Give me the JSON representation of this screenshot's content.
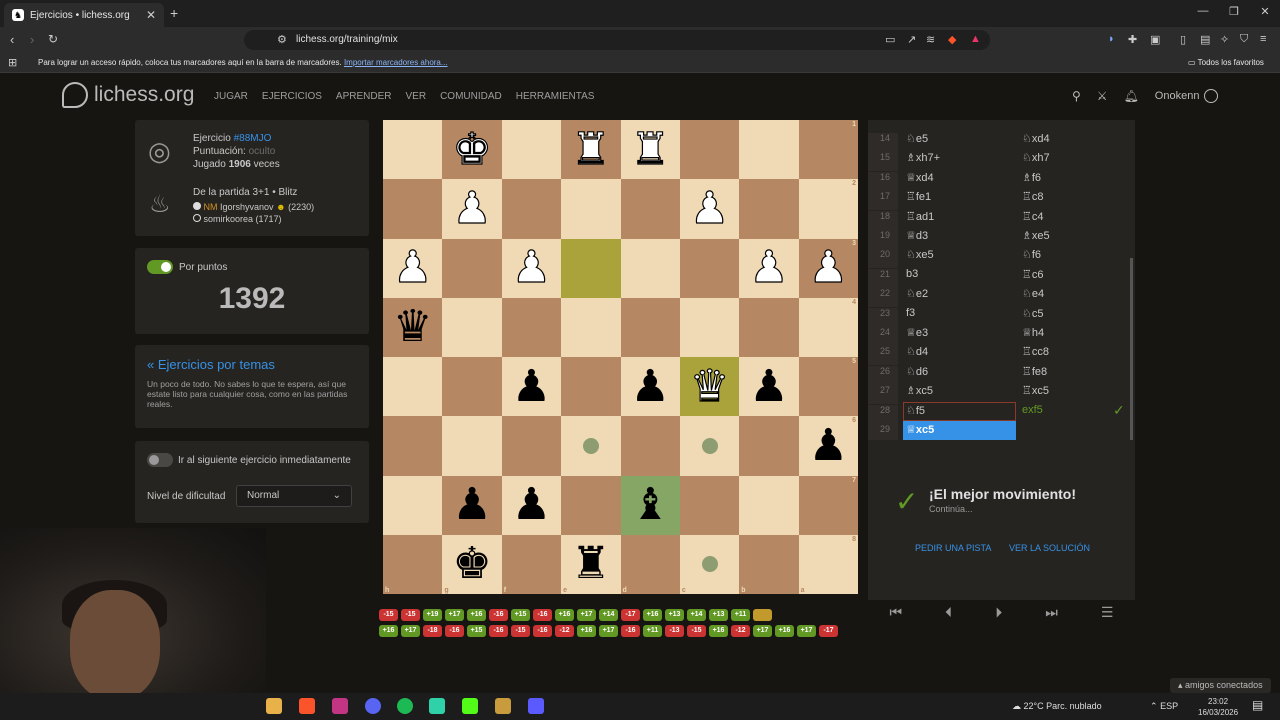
{
  "browser": {
    "tab_title": "Ejercicios • lichess.org",
    "new_tab": "+",
    "url": "lichess.org/training/mix",
    "bookmarks_text": "Para lograr un acceso rápido, coloca tus marcadores aquí en la barra de marcadores.",
    "bookmarks_link": "Importar marcadores ahora...",
    "all_favorites": "Todos los favoritos"
  },
  "site": {
    "logo": "lichess.org",
    "nav": [
      "JUGAR",
      "EJERCICIOS",
      "APRENDER",
      "VER",
      "COMUNIDAD",
      "HERRAMIENTAS"
    ],
    "username": "Onokenn"
  },
  "puzzle": {
    "exercise_label": "Ejercicio",
    "exercise_id": "#88MJO",
    "rating_label": "Puntuación:",
    "rating_value": "oculto",
    "played_label": "Jugado",
    "played_count": "1906",
    "played_suffix": "veces",
    "game_line": "De la partida 3+1 • Blitz",
    "player1_title": "NM",
    "player1": "Igorshyvanov",
    "player1_rating": "(2230)",
    "player2": "somirkoorea (1717)"
  },
  "rated": {
    "label": "Por puntos",
    "score": "1392"
  },
  "theme": {
    "link": "« Ejercicios por temas",
    "desc": "Un poco de todo. No sabes lo que te espera, así que estate listo para cualquier cosa, como en las partidas reales."
  },
  "settings": {
    "auto_next": "Ir al siguiente ejercicio inmediatamente",
    "difficulty_label": "Nivel de dificultad",
    "difficulty_value": "Normal"
  },
  "board": {
    "ranks": [
      "1",
      "2",
      "3",
      "4",
      "5",
      "6",
      "7",
      "8"
    ],
    "files": [
      "h",
      "g",
      "f",
      "e",
      "d",
      "c",
      "b",
      "a"
    ],
    "pieces": [
      [
        "",
        "wK",
        "",
        "wR",
        "wR",
        "",
        "",
        ""
      ],
      [
        "",
        "wP",
        "",
        "",
        "",
        "wP",
        "",
        ""
      ],
      [
        "wP",
        "",
        "wP",
        "",
        "",
        "",
        "wP",
        "wP"
      ],
      [
        "bQ",
        "",
        "",
        "",
        "",
        "",
        "",
        ""
      ],
      [
        "",
        "",
        "bP",
        "",
        "bP",
        "wQ",
        "bP",
        ""
      ],
      [
        "",
        "",
        "",
        "",
        "",
        "",
        "",
        "bP"
      ],
      [
        "",
        "bP",
        "bP",
        "",
        "bB",
        "",
        "",
        ""
      ],
      [
        "",
        "bK",
        "",
        "bR",
        "",
        "",
        "",
        ""
      ]
    ],
    "highlight_last": [
      [
        2,
        3
      ],
      [
        4,
        5
      ]
    ],
    "highlight_selected": [
      [
        6,
        4
      ]
    ],
    "move_dots": [
      [
        5,
        3
      ],
      [
        5,
        5
      ],
      [
        7,
        5
      ]
    ]
  },
  "moves": [
    {
      "n": "14",
      "w": "♘e5",
      "b": "♘xd4"
    },
    {
      "n": "15",
      "w": "♗xh7+",
      "b": "♘xh7"
    },
    {
      "n": "16",
      "w": "♕xd4",
      "b": "♗f6"
    },
    {
      "n": "17",
      "w": "♖fe1",
      "b": "♖c8"
    },
    {
      "n": "18",
      "w": "♖ad1",
      "b": "♖c4"
    },
    {
      "n": "19",
      "w": "♕d3",
      "b": "♗xe5"
    },
    {
      "n": "20",
      "w": "♘xe5",
      "b": "♘f6"
    },
    {
      "n": "21",
      "w": "b3",
      "b": "♖c6"
    },
    {
      "n": "22",
      "w": "♘e2",
      "b": "♘e4"
    },
    {
      "n": "23",
      "w": "f3",
      "b": "♘c5"
    },
    {
      "n": "24",
      "w": "♕e3",
      "b": "♕h4"
    },
    {
      "n": "25",
      "w": "♘d4",
      "b": "♖cc8"
    },
    {
      "n": "26",
      "w": "♘d6",
      "b": "♖fe8"
    },
    {
      "n": "27",
      "w": "♗xc5",
      "b": "♖xc5"
    },
    {
      "n": "28",
      "w": "♘f5",
      "b": "exf5"
    },
    {
      "n": "29",
      "w": "♕xc5",
      "b": ""
    }
  ],
  "feedback": {
    "check": "✓",
    "title": "¡El mejor movimiento!",
    "subtitle": "Continúa...",
    "hint": "PEDIR UNA PISTA",
    "solution": "VER LA SOLUCIÓN"
  },
  "history_row1": [
    {
      "v": "-15",
      "c": "r"
    },
    {
      "v": "-15",
      "c": "r"
    },
    {
      "v": "+19",
      "c": "g"
    },
    {
      "v": "+17",
      "c": "g"
    },
    {
      "v": "+16",
      "c": "g"
    },
    {
      "v": "-16",
      "c": "r"
    },
    {
      "v": "+15",
      "c": "g"
    },
    {
      "v": "-16",
      "c": "r"
    },
    {
      "v": "+16",
      "c": "g"
    },
    {
      "v": "+17",
      "c": "g"
    },
    {
      "v": "+14",
      "c": "g"
    },
    {
      "v": "-17",
      "c": "r"
    },
    {
      "v": "+16",
      "c": "g"
    },
    {
      "v": "+13",
      "c": "g"
    },
    {
      "v": "+14",
      "c": "g"
    },
    {
      "v": "+13",
      "c": "g"
    },
    {
      "v": "+11",
      "c": "g"
    },
    {
      "v": "",
      "c": "o"
    }
  ],
  "history_row2": [
    {
      "v": "+16",
      "c": "g"
    },
    {
      "v": "+17",
      "c": "g"
    },
    {
      "v": "-18",
      "c": "r"
    },
    {
      "v": "-16",
      "c": "r"
    },
    {
      "v": "+15",
      "c": "g"
    },
    {
      "v": "-16",
      "c": "r"
    },
    {
      "v": "-15",
      "c": "r"
    },
    {
      "v": "-16",
      "c": "r"
    },
    {
      "v": "-12",
      "c": "r"
    },
    {
      "v": "+16",
      "c": "g"
    },
    {
      "v": "+17",
      "c": "g"
    },
    {
      "v": "-16",
      "c": "r"
    },
    {
      "v": "+11",
      "c": "g"
    },
    {
      "v": "-13",
      "c": "r"
    },
    {
      "v": "-15",
      "c": "r"
    },
    {
      "v": "+16",
      "c": "g"
    },
    {
      "v": "-12",
      "c": "r"
    },
    {
      "v": "+17",
      "c": "g"
    },
    {
      "v": "+16",
      "c": "g"
    },
    {
      "v": "+17",
      "c": "g"
    },
    {
      "v": "-17",
      "c": "r"
    }
  ],
  "taskbar": {
    "weather": "22°C  Parc. nublado",
    "lang": "ESP",
    "time": "23:02",
    "date": "16/03/2026",
    "friends": "amigos conectados"
  },
  "colors": {
    "accent_blue": "#3692e7",
    "success_green": "#629924",
    "error_red": "#cc3333"
  }
}
